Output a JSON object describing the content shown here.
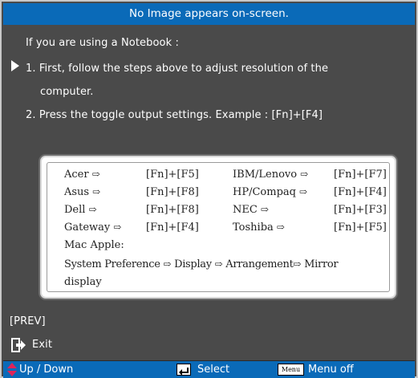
{
  "window": {
    "title": "No Image appears on-screen."
  },
  "content": {
    "heading": "If you are using a Notebook :",
    "step1_line1": "1. First, follow the steps above to adjust resolution of the",
    "step1_line2": "computer.",
    "step2": "2. Press the toggle output settings. Example : [Fn]+[F4]"
  },
  "notebook_table": {
    "rows": [
      [
        {
          "name": "Acer",
          "key": "[Fn]+[F5]"
        },
        {
          "name": "IBM/Lenovo",
          "key": "[Fn]+[F7]"
        }
      ],
      [
        {
          "name": "Asus",
          "key": "[Fn]+[F8]"
        },
        {
          "name": "HP/Compaq",
          "key": "[Fn]+[F4]"
        }
      ],
      [
        {
          "name": "Dell",
          "key": "[Fn]+[F8]"
        },
        {
          "name": "NEC",
          "key": "[Fn]+[F3]"
        }
      ],
      [
        {
          "name": "Gateway",
          "key": "[Fn]+[F4]"
        },
        {
          "name": "Toshiba",
          "key": "[Fn]+[F5]"
        }
      ]
    ],
    "mac_label": "Mac Apple:",
    "mac_path": [
      "System Preference",
      "Display",
      "Arrangement",
      "Mirror"
    ],
    "mac_last": "display",
    "arrow_icon": "⇨"
  },
  "nav": {
    "prev": "[PREV]",
    "exit": "Exit"
  },
  "footer": {
    "updown": "Up / Down",
    "select": "Select",
    "menu_key": "Menu",
    "menu_off": "Menu off"
  },
  "colors": {
    "background": "#4a4a4a",
    "bar": "#0a6ab8",
    "updown_arrow": "#e0245a"
  }
}
